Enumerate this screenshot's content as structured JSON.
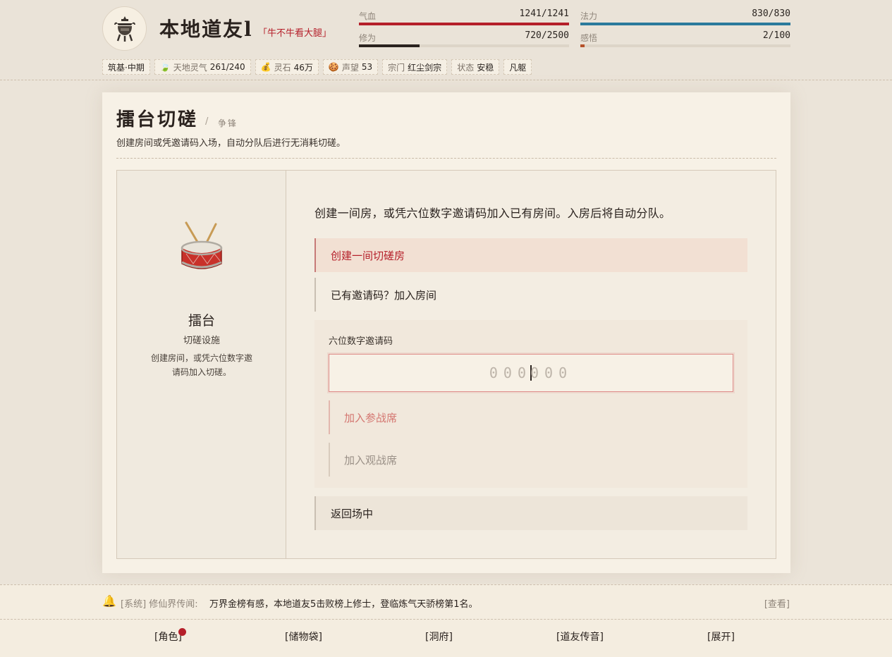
{
  "player": {
    "name": "本地道友l",
    "tag": "「牛不牛看大腿」"
  },
  "stats": [
    {
      "label": "气血",
      "value": "1241/1241",
      "fraction": 1.0,
      "color": "#b51f2a"
    },
    {
      "label": "法力",
      "value": "830/830",
      "fraction": 1.0,
      "color": "#2b7a9c"
    },
    {
      "label": "修为",
      "value": "720/2500",
      "fraction": 0.288,
      "color": "#2a221e"
    },
    {
      "label": "感悟",
      "value": "2/100",
      "fraction": 0.02,
      "color": "#b5512a"
    }
  ],
  "chips": {
    "realm": "筑基·中期",
    "qi_label": "天地灵气",
    "qi_value": "261/240",
    "stone_label": "灵石",
    "stone_value": "46万",
    "fame_label": "声望",
    "fame_value": "53",
    "sect_label": "宗门",
    "sect_value": "红尘剑宗",
    "state_label": "状态",
    "state_value": "安稳",
    "body": "凡躯"
  },
  "page": {
    "title": "擂台切磋",
    "separator": "/",
    "subtitle": "争锋",
    "description": "创建房间或凭邀请码入场，自动分队后进行无消耗切磋。"
  },
  "facility": {
    "name": "擂台",
    "kind": "切磋设施",
    "desc_line1": "创建房间，或凭六位数字邀",
    "desc_line2": "请码加入切磋。"
  },
  "arena": {
    "intro": "创建一间房，或凭六位数字邀请码加入已有房间。入房后将自动分队。",
    "create_room": "创建一间切磋房",
    "join_with_code": "已有邀请码？加入房间",
    "code_label": "六位数字邀请码",
    "code_left": "000",
    "code_right": "000",
    "join_fighter": "加入参战席",
    "join_spectator": "加入观战席",
    "back": "返回场中"
  },
  "news": {
    "tag": "[系统] 修仙界传闻:",
    "text": "万界金榜有感，本地道友5击败榜上修士，登临炼气天骄榜第1名。",
    "view": "[查看]"
  },
  "nav": {
    "role": "[角色]",
    "bag": "[储物袋]",
    "cave": "[洞府]",
    "message": "[道友传音]",
    "expand": "[展开]"
  }
}
